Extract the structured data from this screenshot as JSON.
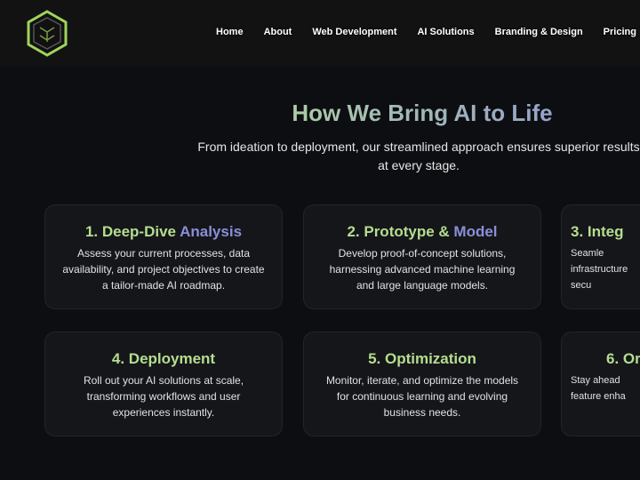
{
  "brand": {
    "accent_green": "#b5de8e",
    "accent_purple": "#8a8fd8",
    "logo_icon": "hexagon-circuit-logo"
  },
  "nav": [
    "Home",
    "About",
    "Web Development",
    "AI Solutions",
    "Branding & Design",
    "Pricing"
  ],
  "section": {
    "title": "How We Bring AI to Life",
    "subtitle": "From ideation to deployment, our streamlined approach ensures superior results at every stage."
  },
  "cards": [
    {
      "title_a": "1. Deep-Dive",
      "title_b": " Analysis",
      "text": "Assess your current processes, data availability, and project objectives to create a tailor-made AI roadmap."
    },
    {
      "title_a": "2. Prototype &",
      "title_b": " Model",
      "text": "Develop proof-of-concept solutions, harnessing advanced machine learning and large language models."
    },
    {
      "title_a": "3. Integ",
      "title_b": "",
      "text": "Seamle infrastructure secu"
    },
    {
      "title_a": "4. Deployment",
      "title_b": "",
      "text": "Roll out your AI solutions at scale, transforming workflows and user experiences instantly."
    },
    {
      "title_a": "5. Optimization",
      "title_b": "",
      "text": "Monitor, iterate, and optimize the models for continuous learning and evolving business needs."
    },
    {
      "title_a": "6. Or",
      "title_b": "",
      "text": "Stay ahead feature enha"
    }
  ]
}
